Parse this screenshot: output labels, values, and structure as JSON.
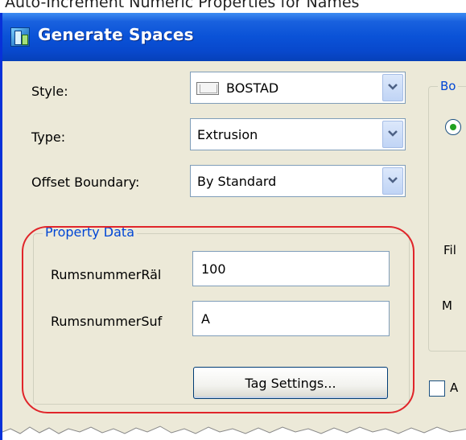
{
  "top_caption": "Auto-Increment Numeric Properties for Names",
  "dialog": {
    "title": "Generate Spaces",
    "title_icon": "app-icon"
  },
  "form": {
    "style": {
      "label": "Style:",
      "value": "BOSTAD"
    },
    "type": {
      "label": "Type:",
      "value": "Extrusion"
    },
    "offset": {
      "label": "Offset Boundary:",
      "value": "By Standard"
    }
  },
  "property_data": {
    "legend": "Property Data",
    "fields": [
      {
        "label": "RumsnummerRäl",
        "value": "100"
      },
      {
        "label": "RumsnummerSuf",
        "value": "A"
      }
    ],
    "tag_button": "Tag Settings..."
  },
  "right_panel": {
    "legend_partial": "Bo",
    "text_fill": "Fil",
    "text_m": "M",
    "checkbox_label": "A"
  },
  "colors": {
    "title_bar": "#0a52d7",
    "highlight": "#e0252a",
    "group_legend": "#0046d5"
  }
}
